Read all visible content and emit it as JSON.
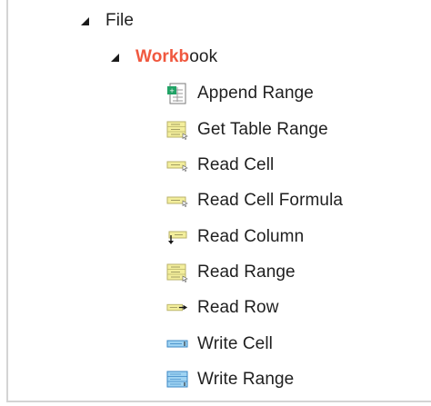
{
  "tree": {
    "file": {
      "label": "File"
    },
    "workbook": {
      "highlight": "Workb",
      "rest": "ook"
    },
    "items": [
      {
        "label": "Append Range",
        "icon": "append-range-icon"
      },
      {
        "label": "Get Table Range",
        "icon": "get-table-range-icon"
      },
      {
        "label": "Read Cell",
        "icon": "read-cell-icon"
      },
      {
        "label": "Read Cell Formula",
        "icon": "read-cell-formula-icon"
      },
      {
        "label": "Read Column",
        "icon": "read-column-icon"
      },
      {
        "label": "Read Range",
        "icon": "read-range-icon"
      },
      {
        "label": "Read Row",
        "icon": "read-row-icon"
      },
      {
        "label": "Write Cell",
        "icon": "write-cell-icon"
      },
      {
        "label": "Write Range",
        "icon": "write-range-icon"
      }
    ]
  },
  "colors": {
    "search_highlight": "#f0583f",
    "cell_fill": "#f3ee9c",
    "cell_border": "#b9b26a",
    "write_fill": "#9fd3f2",
    "write_border": "#3b87c4",
    "excel_green": "#21a366"
  }
}
